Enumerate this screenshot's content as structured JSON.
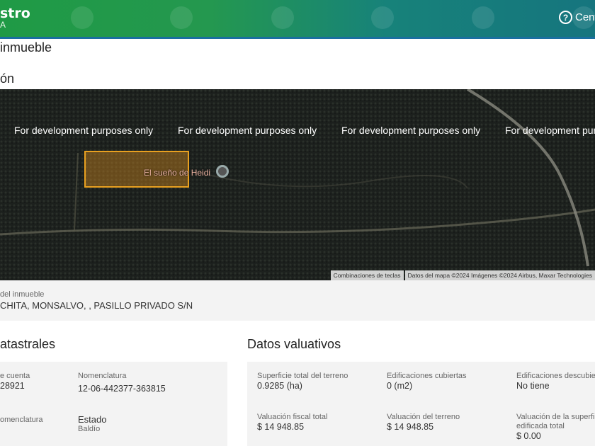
{
  "header": {
    "logo": "stro",
    "logo_sub": "A",
    "help_label": "Cent",
    "help_icon": "question-circle-icon"
  },
  "page_title": "inmueble",
  "location_title": "ón",
  "map": {
    "watermarks": [
      "For development purposes only",
      "For development purposes only",
      "For development purposes only",
      "For development purposes only"
    ],
    "place_label": "El sueño de Heidi",
    "shortcuts": "Combinaciones de teclas",
    "attribution": "Datos del mapa ©2024 Imágenes ©2024 Airbus, Maxar Technologies"
  },
  "address": {
    "label": "del inmueble",
    "value": "CHITA, MONSALVO, , PASILLO PRIVADO S/N"
  },
  "catastrales": {
    "title": "atastrales",
    "fields": [
      {
        "label": "e cuenta",
        "value": "28921"
      },
      {
        "label": "Nomenclatura",
        "value": "12-06-442377-363815"
      },
      {
        "label": "omenclatura",
        "value": ""
      },
      {
        "label": "Estado",
        "value": "Baldío"
      }
    ]
  },
  "valuativos": {
    "title": "Datos valuativos",
    "fields": [
      {
        "label": "Superficie total del terreno",
        "value": "0.9285 (ha)"
      },
      {
        "label": "Edificaciones cubiertas",
        "value": "0 (m2)"
      },
      {
        "label": "Edificaciones descubie",
        "value": "No tiene"
      },
      {
        "label": "Valuación fiscal total",
        "value": "$ 14 948.85"
      },
      {
        "label": "Valuación del terreno",
        "value": "$ 14 948.85"
      },
      {
        "label": "Valuación de la superficie edificada total",
        "value": "$ 0.00"
      }
    ]
  }
}
